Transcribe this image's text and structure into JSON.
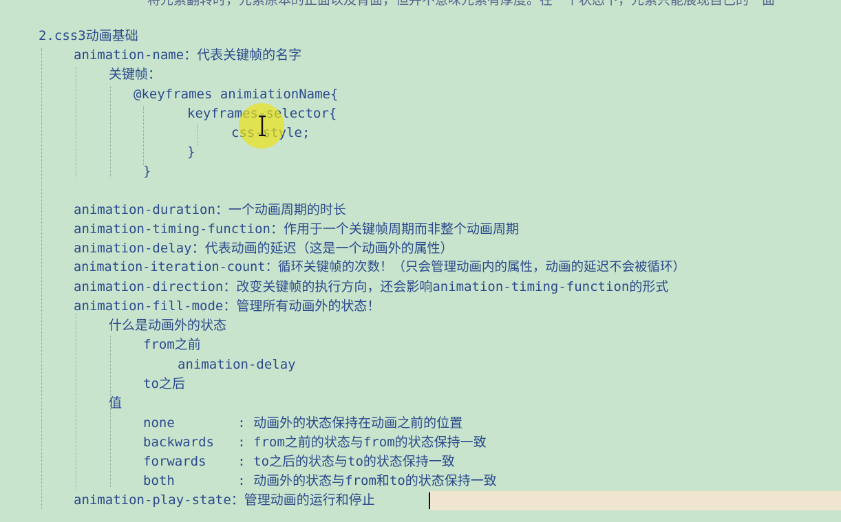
{
  "document": {
    "top_cut_line": "将元素翻转时，元素原本的正面以及背面，但并不意味元素有厚度。在一个状态下，元素只能展现自己的一面",
    "section_title": "2.css3动画基础",
    "props": {
      "name": "animation-name：代表关键帧的名字",
      "keyframes_label": "关键帧：",
      "keyframes_open": "@keyframes animiationName{",
      "selector_open": "keyframes-selector{",
      "css_style": "css-style;",
      "selector_close": "}",
      "keyframes_close": "}",
      "duration": "animation-duration：一个动画周期的时长",
      "timing_function": "animation-timing-function：作用于一个关键帧周期而非整个动画周期",
      "delay": "animation-delay：代表动画的延迟（这是一个动画外的属性）",
      "iteration_count": "animation-iteration-count：循环关键帧的次数！（只会管理动画内的属性，动画的延迟不会被循环）",
      "direction": "animation-direction：改变关键帧的执行方向，还会影响animation-timing-function的形式",
      "fill_mode": "animation-fill-mode：管理所有动画外的状态！",
      "what_is_outside": "什么是动画外的状态",
      "from_before": "from之前",
      "animation_delay": "animation-delay",
      "to_after": "to之后",
      "values_label": "值",
      "value_none": "none        : 动画外的状态保持在动画之前的位置",
      "value_backwards": "backwards   : from之前的状态与from的状态保持一致",
      "value_forwards": "forwards    : to之后的状态与to的状态保持一致",
      "value_both": "both        : 动画外的状态与from和to的状态保持一致",
      "play_state": "animation-play-state：管理动画的运行和停止"
    }
  },
  "colors": {
    "background": "#c9e4cd",
    "text": "#2b4a8c",
    "current_line": "#f0e6cf",
    "cursor_highlight": "#ebe114"
  },
  "icons": {
    "text_cursor": "text-cursor-icon"
  }
}
